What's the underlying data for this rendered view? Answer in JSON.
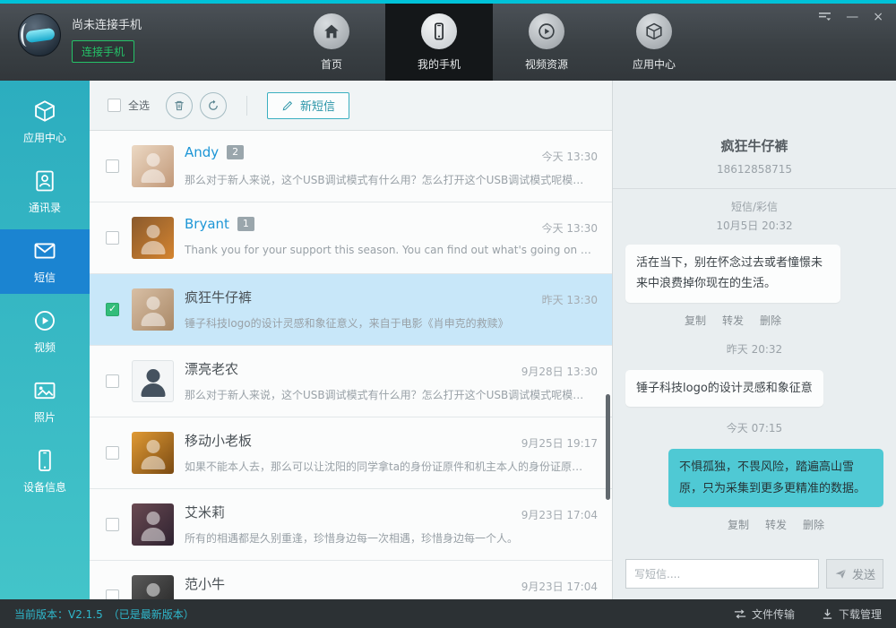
{
  "colors": {
    "accent_teal": "#2fb9cd",
    "sidebar_teal": "#2cadbf",
    "active_blue": "#1b84d1",
    "connect_green": "#25c368",
    "sent_bubble": "#4fc9d4",
    "selected_row": "#c8e7f9"
  },
  "window": {
    "status_text": "尚未连接手机",
    "connect_label": "连接手机",
    "minimize_glyph": "—",
    "close_glyph": "×"
  },
  "nav": {
    "tabs": [
      {
        "label": "首页"
      },
      {
        "label": "我的手机"
      },
      {
        "label": "视频资源"
      },
      {
        "label": "应用中心"
      }
    ]
  },
  "sidebar": {
    "items": [
      {
        "label": "应用中心"
      },
      {
        "label": "通讯录"
      },
      {
        "label": "短信"
      },
      {
        "label": "视频"
      },
      {
        "label": "照片"
      },
      {
        "label": "设备信息"
      }
    ]
  },
  "toolbar": {
    "select_all_label": "全选",
    "new_sms_label": "新短信"
  },
  "conversations": [
    {
      "name": "Andy",
      "badge": "2",
      "date": "今天 13:30",
      "preview": "那么对于新人来说，这个USB调试模式有什么用？怎么打开这个USB调试模式呢模式呢..."
    },
    {
      "name": "Bryant",
      "badge": "1",
      "date": "今天 13:30",
      "preview": "Thank you for your support this season. You can find out what's going on in my world"
    },
    {
      "name": "疯狂牛仔裤",
      "date": "昨天 13:30",
      "preview": "锤子科技logo的设计灵感和象征意义，来自于电影《肖申克的救赎》"
    },
    {
      "name": "漂亮老农",
      "date": "9月28日 13:30",
      "preview": "那么对于新人来说，这个USB调试模式有什么用？怎么打开这个USB调试模式呢模式呢..."
    },
    {
      "name": "移动小老板",
      "date": "9月25日 19:17",
      "preview": "如果不能本人去，那么可以让沈阳的同学拿ta的身份证原件和机主本人的身份证原件..."
    },
    {
      "name": "艾米莉",
      "date": "9月23日 17:04",
      "preview": "所有的相遇都是久别重逢，珍惜身边每一次相遇，珍惜身边每一个人。"
    },
    {
      "name": "范小牛",
      "date": "9月23日 17:04",
      "preview": ""
    }
  ],
  "detail": {
    "title": "疯狂牛仔裤",
    "phone": "18612858715",
    "type_label": "短信/彩信",
    "start_time": "10月5日 20:32",
    "messages": [
      {
        "type": "received",
        "text": "活在当下，别在怀念过去或者憧憬未来中浪费掉你现在的生活。"
      },
      {
        "type": "timestamp",
        "text": "昨天 20:32"
      },
      {
        "type": "received",
        "text": "锤子科技logo的设计灵感和象征意"
      },
      {
        "type": "timestamp",
        "text": "今天 07:15"
      },
      {
        "type": "sent",
        "text": "不惧孤独，不畏风险，踏遍高山雪原，只为采集到更多更精准的数据。"
      }
    ],
    "actions": {
      "copy": "复制",
      "forward": "转发",
      "delete": "删除"
    },
    "compose": {
      "placeholder": "写短信....",
      "send_label": "发送"
    }
  },
  "statusbar": {
    "version": "当前版本：V2.1.5",
    "version_note": "（已是最新版本）",
    "file_transfer": "文件传输",
    "download_manager": "下载管理"
  }
}
